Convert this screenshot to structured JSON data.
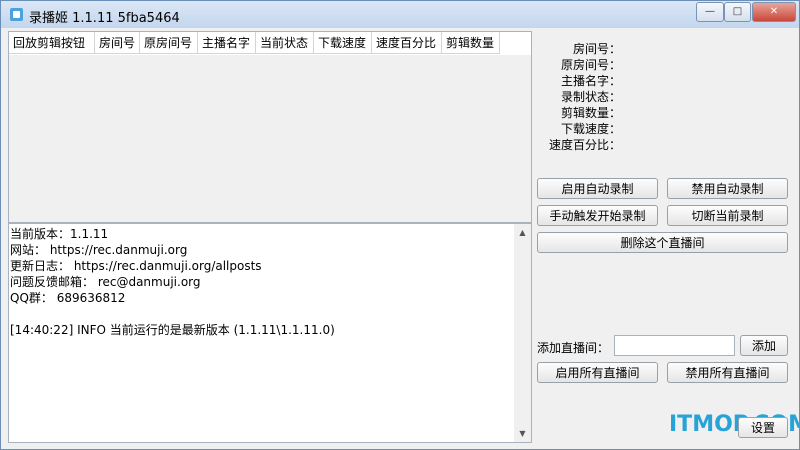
{
  "window": {
    "title": "录播姬 1.1.11 5fba5464",
    "controls": {
      "minimize": "—",
      "maximize": "□",
      "close": "✕"
    }
  },
  "room_list": {
    "columns": [
      "回放剪辑按钮",
      "房间号",
      "原房间号",
      "主播名字",
      "当前状态",
      "下载速度",
      "速度百分比",
      "剪辑数量"
    ]
  },
  "log": {
    "lines": [
      "当前版本：1.1.11",
      "网站： https://rec.danmuji.org",
      "更新日志： https://rec.danmuji.org/allposts",
      "问题反馈邮箱： rec@danmuji.org",
      "QQ群： 689636812",
      "",
      "[14:40:22] INFO  当前运行的是最新版本 (1.1.11\\1.1.11.0)"
    ]
  },
  "details": {
    "labels": [
      "房间号：",
      "原房间号：",
      "主播名字：",
      "录制状态：",
      "剪辑数量：",
      "下载速度：",
      "速度百分比："
    ]
  },
  "buttons": {
    "enable_auto": "启用自动录制",
    "disable_auto": "禁用自动录制",
    "manual_start": "手动触发开始录制",
    "cut_current": "切断当前录制",
    "delete_room": "删除这个直播间",
    "add": "添加",
    "enable_all": "启用所有直播间",
    "disable_all": "禁用所有直播间",
    "settings": "设置"
  },
  "add_room": {
    "label": "添加直播间：",
    "value": ""
  },
  "watermark": "ITMOP.COM"
}
